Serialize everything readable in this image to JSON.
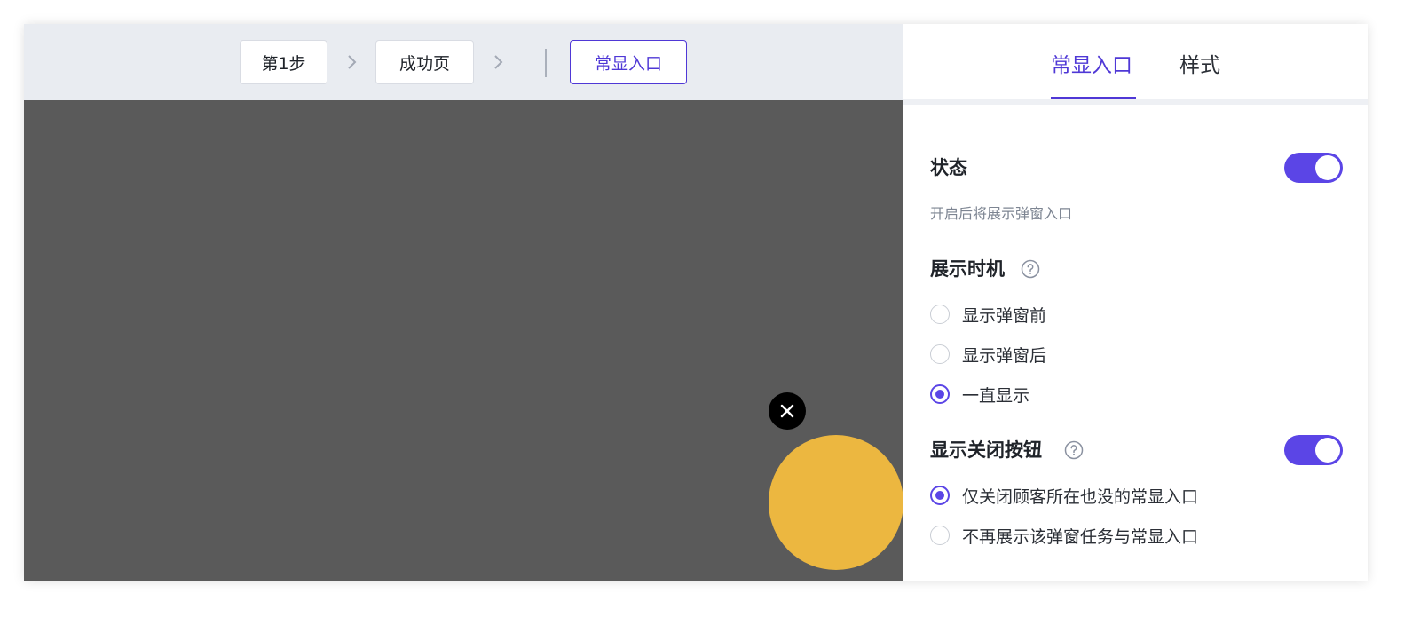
{
  "steps": {
    "step1": "第1步",
    "success_page": "成功页",
    "persistent_entry": "常显入口"
  },
  "tabs": {
    "entry_tab": "常显入口",
    "style_tab": "样式"
  },
  "status": {
    "label": "状态",
    "hint": "开启后将展示弹窗入口",
    "enabled": true
  },
  "display_timing": {
    "label": "展示时机",
    "help_icon": "question-circle-icon",
    "options": [
      "显示弹窗前",
      "显示弹窗后",
      "一直显示"
    ],
    "selected": "一直显示"
  },
  "close_button": {
    "label": "显示关闭按钮",
    "help_icon": "question-circle-icon",
    "enabled": true,
    "options": [
      "仅关闭顾客所在也没的常显入口",
      "不再展示该弹窗任务与常显入口"
    ],
    "selected": "仅关闭顾客所在也没的常显入口"
  },
  "preview": {
    "close_icon": "close-icon",
    "entry_color": "#ecb740",
    "canvas_color": "#5a5a5a"
  },
  "colors": {
    "accent": "#5b45e6",
    "active_text": "#4f38d6"
  }
}
